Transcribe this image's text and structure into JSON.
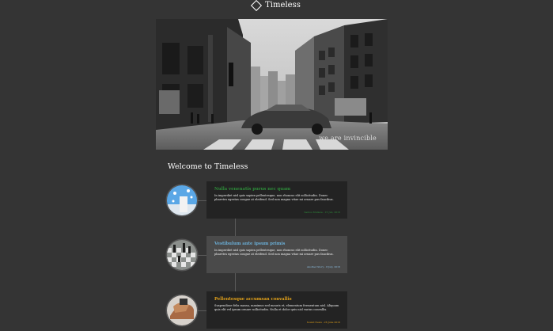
{
  "header": {
    "brand": "Timeless"
  },
  "hero": {
    "caption": "we are invincible"
  },
  "main": {
    "heading": "Welcome to Timeless"
  },
  "timeline": [
    {
      "title": "Nulla venenatis purus nec quam",
      "text": "In imperdiet nisl quis sapien pellentesque, non rhoncus elit sollicitudin. Donec pharetra egestas congue at eleifend. Sed non magna vitae mi ornare pus faucibus.",
      "meta": "Santos Mulleza - 15 Jun, 2016",
      "title_color": "#2e8b3a",
      "meta_color": "#2e8b3a"
    },
    {
      "title": "Vestibulum ante ipsum primis",
      "text": "In imperdiet nisl quis sapien pellentesque, non rhoncus elit sollicitudin. Donec pharetra egestas congue at eleifend. Sed non magna vitae mi ornare pus faucibus.",
      "meta": "Another Story - 8 July, 2016",
      "title_color": "#6aaed6",
      "meta_color": "#8fc4e8"
    },
    {
      "title": "Pellentesque accumsan convallis",
      "text": "Suspendisse felis massa, maximus sed mauris et, elementum fermentum nisl. Aliquam quis elit vel ipsum ornare sollicitudin. Nulla et dolor quis nisl varius convallis.",
      "meta": "Sound News - 26 June 2016",
      "title_color": "#e3a21a",
      "meta_color": "#e3a21a"
    }
  ]
}
